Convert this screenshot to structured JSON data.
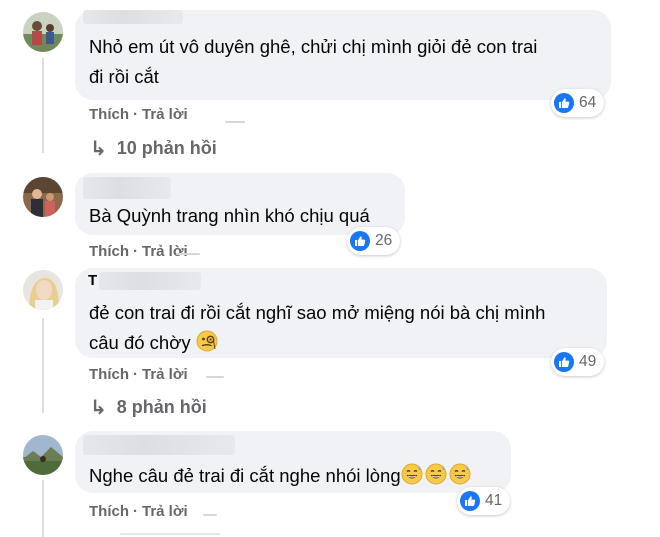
{
  "comments": [
    {
      "text_lines": [
        "Nhỏ em út vô duyên ghê, chửi chị mình giỏi đẻ con trai",
        "đi rồi cắt"
      ],
      "like_label": "Thích",
      "reply_label": "Trả lời",
      "reaction_count": "64",
      "replies_label": "10 phản hồi"
    },
    {
      "text_lines": [
        "Bà Quỳnh trang nhìn khó chịu quá"
      ],
      "like_label": "Thích",
      "reply_label": "Trả lời",
      "reaction_count": "26"
    },
    {
      "name_fragment": "T",
      "text_lines": [
        "đẻ con trai đi rồi cắt nghĩ sao mở miệng nói bà chị mình",
        "câu đó chờy"
      ],
      "like_label": "Thích",
      "reply_label": "Trả lời",
      "reaction_count": "49",
      "replies_label": "8 phản hồi"
    },
    {
      "text_lines": [
        "Nghe câu đẻ trai đi cắt nghe nhói lòng"
      ],
      "like_label": "Thích",
      "reply_label": "Trả lời",
      "reaction_count": "41"
    }
  ],
  "icons": {
    "reaction": "like-icon",
    "reply_arrow": "reply-arrow-icon",
    "emoji_comment3": "face-with-monocle-emoji",
    "emoji_comment4": "grinning-sweat-emoji"
  },
  "colors": {
    "bubble": "#f0f2f5",
    "like_blue": "#1877f2",
    "secondary_text": "#65676b"
  }
}
